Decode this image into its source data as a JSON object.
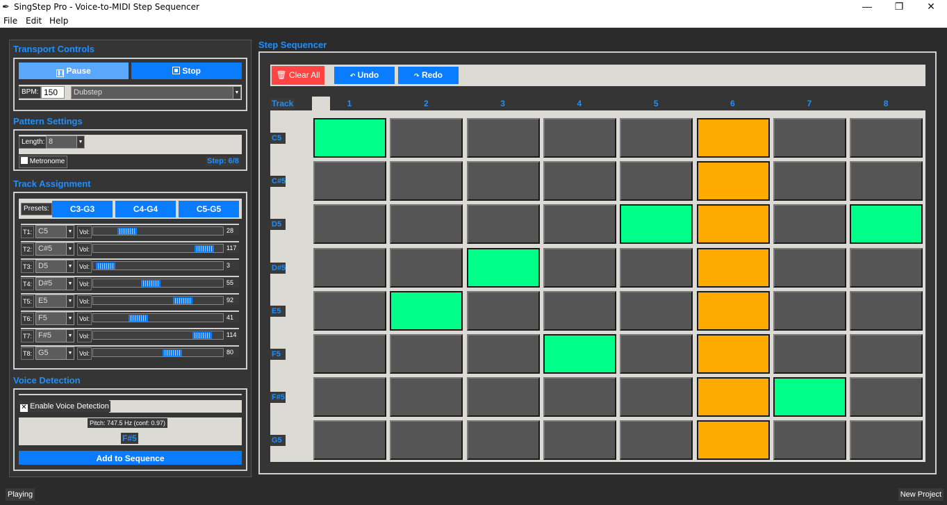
{
  "window": {
    "title": "SingStep Pro - Voice-to-MIDI Step Sequencer",
    "minimize": "—",
    "maximize": "❐",
    "close": "✕"
  },
  "menu": [
    "File",
    "Edit",
    "Help"
  ],
  "transport": {
    "title": "Transport Controls",
    "pause_label": "Pause",
    "stop_label": "Stop",
    "bpm_label": "BPM:",
    "bpm_value": "150",
    "genre_value": "Dubstep"
  },
  "pattern": {
    "title": "Pattern Settings",
    "length_label": "Length:",
    "length_value": "8",
    "metronome_label": "Metronome",
    "metronome_checked": false,
    "step_status": "Step: 6/8"
  },
  "tracks": {
    "title": "Track Assignment",
    "presets_label": "Presets:",
    "presets": [
      "C3-G3",
      "C4-G4",
      "C5-G5"
    ],
    "vol_label": "Vol:",
    "rows": [
      {
        "label": "T1:",
        "note": "C5",
        "vol": 28
      },
      {
        "label": "T2:",
        "note": "C#5",
        "vol": 117
      },
      {
        "label": "T3:",
        "note": "D5",
        "vol": 3
      },
      {
        "label": "T4:",
        "note": "D#5",
        "vol": 55
      },
      {
        "label": "T5:",
        "note": "E5",
        "vol": 92
      },
      {
        "label": "T6:",
        "note": "F5",
        "vol": 41
      },
      {
        "label": "T7:",
        "note": "F#5",
        "vol": 114
      },
      {
        "label": "T8:",
        "note": "G5",
        "vol": 80
      }
    ]
  },
  "voice": {
    "title": "Voice Detection",
    "enable_label": "Enable Voice Detection",
    "enable_checked": true,
    "pitch_text": "Pitch: 747.5 Hz (conf: 0.97)",
    "detected_note": "F#5",
    "add_label": "Add to Sequence"
  },
  "sequencer": {
    "title": "Step Sequencer",
    "clear_label": "Clear All",
    "undo_label": "Undo",
    "redo_label": "Redo",
    "track_header": "Track",
    "steps": [
      "1",
      "2",
      "3",
      "4",
      "5",
      "6",
      "7",
      "8"
    ],
    "current_step": 6,
    "rows": [
      "C5",
      "C#5",
      "D5",
      "D#5",
      "E5",
      "F5",
      "F#5",
      "G5"
    ],
    "active": [
      [
        1,
        0,
        0,
        0,
        0,
        0,
        0,
        0
      ],
      [
        0,
        0,
        0,
        0,
        0,
        0,
        0,
        0
      ],
      [
        0,
        0,
        0,
        0,
        1,
        0,
        0,
        1
      ],
      [
        0,
        0,
        1,
        0,
        0,
        0,
        0,
        0
      ],
      [
        0,
        1,
        0,
        0,
        0,
        0,
        0,
        0
      ],
      [
        0,
        0,
        0,
        1,
        0,
        0,
        0,
        0
      ],
      [
        0,
        0,
        0,
        0,
        0,
        0,
        1,
        0
      ],
      [
        0,
        0,
        0,
        0,
        0,
        0,
        0,
        0
      ]
    ],
    "colors": {
      "active": "#00ff88",
      "current": "#ffaa00",
      "off": "#555555"
    }
  },
  "status": {
    "left": "Playing",
    "right": "New Project"
  }
}
